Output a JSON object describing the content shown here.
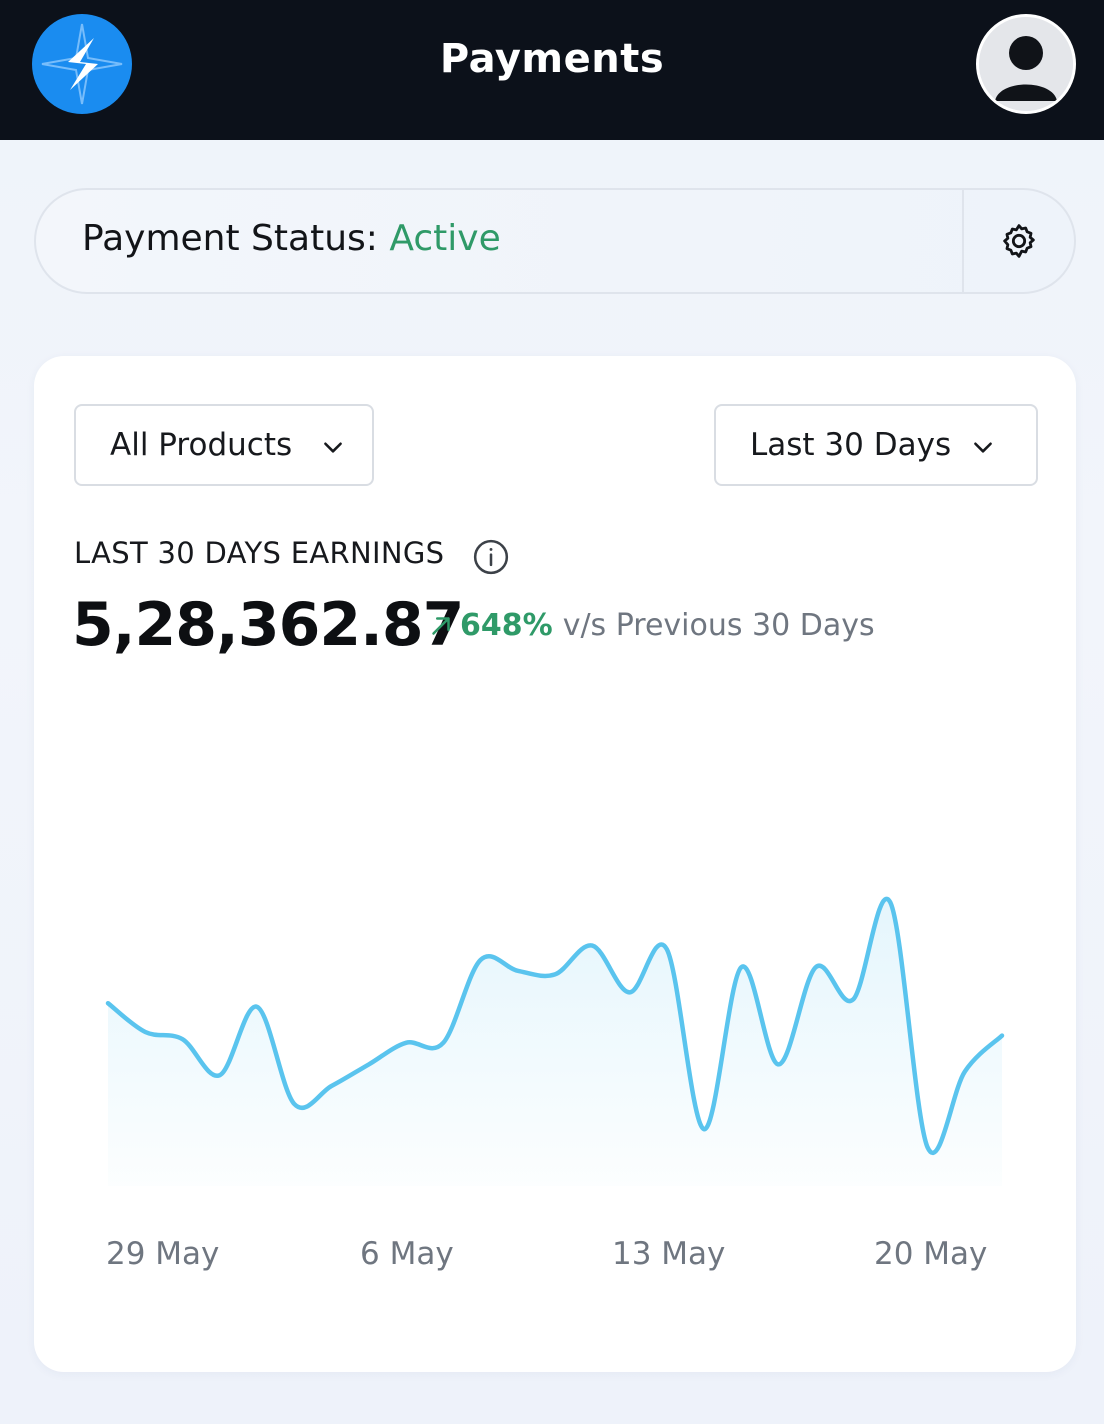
{
  "header": {
    "title": "Payments",
    "logo_icon": "bolt-star-logo-icon",
    "avatar_icon": "user-avatar-icon"
  },
  "status": {
    "label": "Payment Status:",
    "value": "Active",
    "value_color": "#2f9a68",
    "settings_icon": "gear-icon"
  },
  "filters": {
    "products": "All Products",
    "range": "Last 30 Days"
  },
  "earnings": {
    "label": "LAST 30 DAYS EARNINGS",
    "value": "5,28,362.87",
    "trend_pct": "648%",
    "trend_suffix": "v/s Previous 30 Days",
    "trend_color": "#2f9a68"
  },
  "chart_data": {
    "type": "area",
    "line_color": "#5ac4ee",
    "x_ticks": [
      "29 May",
      "6 May",
      "13 May",
      "20 May"
    ],
    "series": [
      {
        "values": [
          48,
          40,
          38,
          28,
          47,
          20,
          25,
          31,
          37,
          37,
          60,
          57,
          56,
          64,
          51,
          63,
          13,
          58,
          31,
          58,
          49,
          76,
          8,
          29,
          39
        ]
      }
    ],
    "ylim": [
      0,
      100
    ],
    "grid": false
  }
}
